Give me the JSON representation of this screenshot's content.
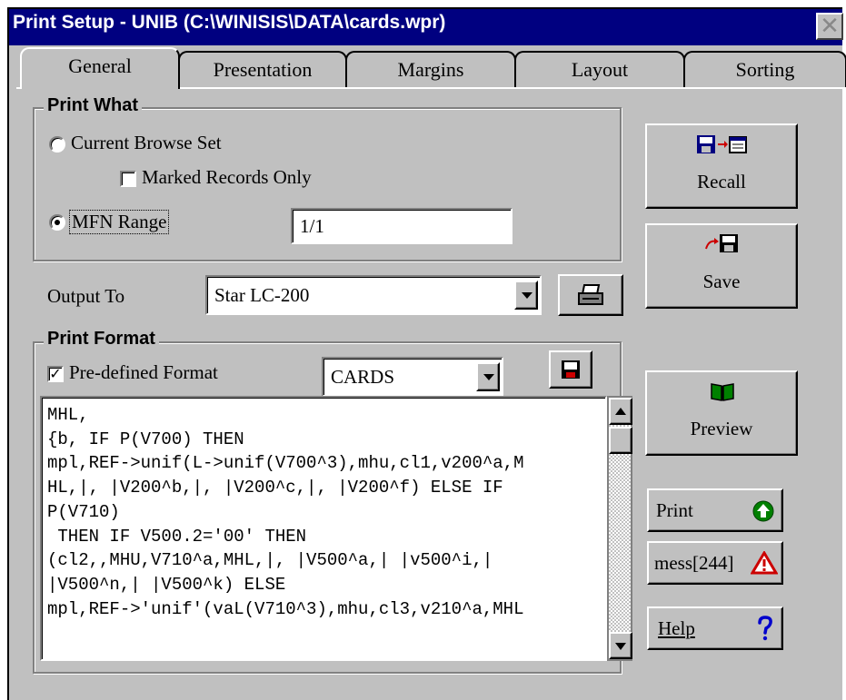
{
  "window": {
    "title": "Print Setup - UNIB (C:\\WINISIS\\DATA\\cards.wpr)",
    "close_glyph": "✕"
  },
  "tabs": [
    "General",
    "Presentation",
    "Margins",
    "Layout",
    "Sorting"
  ],
  "active_tab": "General",
  "print_what": {
    "label": "Print What",
    "current_browse_set": "Current Browse Set",
    "marked_records_only": "Marked Records Only",
    "mfn_range": "MFN Range",
    "mfn_range_value": "1/1",
    "selected": "MFN Range",
    "marked_checked": false
  },
  "output": {
    "label": "Output To",
    "printer": "Star LC-200"
  },
  "print_format": {
    "label": "Print Format",
    "predefined_label": "Pre-defined Format",
    "predefined_checked": true,
    "format_name": "CARDS",
    "code": "MHL,\n{b, IF P(V700) THEN\nmpl,REF->unif(L->unif(V700^3),mhu,cl1,v200^a,M\nHL,|, |V200^b,|, |V200^c,|, |V200^f) ELSE IF\nP(V710)\n THEN IF V500.2='00' THEN\n(cl2,,MHU,V710^a,MHL,|, |V500^a,| |v500^i,|\n|V500^n,| |V500^k) ELSE\nmpl,REF->'unif'(vaL(V710^3),mhu,cl3,v210^a,MHL"
  },
  "buttons": {
    "recall": "Recall",
    "save": "Save",
    "preview": "Preview",
    "print": "Print",
    "mess": "mess[244]",
    "help": "Help"
  },
  "icons": {
    "recall": "floppy-to-window-icon",
    "save": "arrow-to-floppy-icon",
    "printer": "printer-icon",
    "format_save": "floppy-icon",
    "preview": "book-icon",
    "print": "green-up-arrow-icon",
    "mess": "warning-triangle-icon",
    "help": "question-mark-icon"
  },
  "colors": {
    "titlebar": "#000080",
    "face": "#c0c0c0",
    "icon_blue": "#000080",
    "icon_red": "#cc0000",
    "icon_green": "#008000"
  }
}
